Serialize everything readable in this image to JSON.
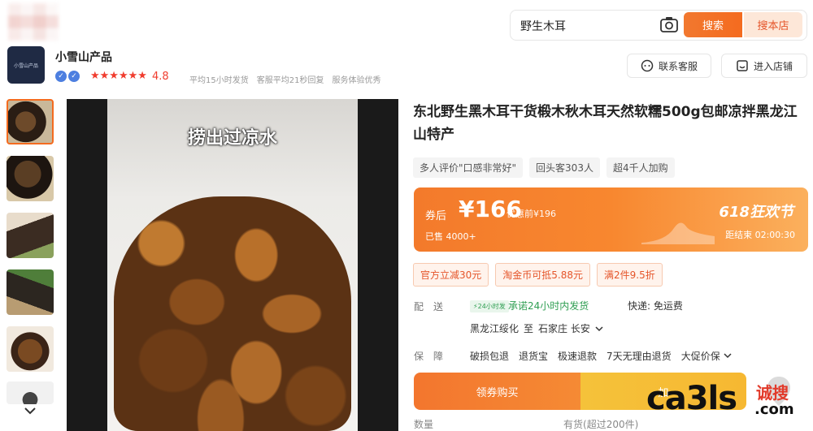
{
  "search": {
    "query": "野生木耳",
    "btn_search": "搜索",
    "btn_store": "搜本店"
  },
  "store": {
    "logo_text": "小雪山产品",
    "name": "小雪山产品",
    "stars": "★★★★★★",
    "rating": "4.8",
    "stats": [
      "平均15小时发货",
      "客服平均21秒回复",
      "服务体验优秀"
    ],
    "service_btn": "联系客服",
    "enter_btn": "进入店铺"
  },
  "image": {
    "caption": "捞出过凉水"
  },
  "product": {
    "title": "东北野生黑木耳干货椴木秋木耳天然软糯500g包邮凉拌黑龙江山特产",
    "tags": [
      "多人评价\"口感非常好\"",
      "回头客303人",
      "超4千人加购"
    ]
  },
  "promo": {
    "after_label": "券后",
    "price": "¥166",
    "before": "优惠前¥196",
    "sold": "已售 4000+",
    "festival": "618狂欢节",
    "countdown": "距结束 02:00:30"
  },
  "coupons": [
    "官方立减30元",
    "淘金币可抵5.88元",
    "满2件9.5折"
  ],
  "delivery": {
    "label": "配送",
    "flash": "⚡24小时发",
    "promise": "承诺24小时内发货",
    "shipping": "快递: 免运费",
    "from": "黑龙江绥化",
    "to_word": "至",
    "to": "石家庄 长安"
  },
  "guarantee": {
    "label": "保障",
    "items": [
      "破损包退",
      "退货宝",
      "极速退款",
      "7天无理由退货",
      "大促价保"
    ]
  },
  "buttons": {
    "coupon_buy": "领券购买",
    "add_cart": "加"
  },
  "quantity": {
    "label": "数量",
    "stock": "有货(超过200件)"
  },
  "watermark": {
    "text": "ca3ls",
    "cn": "诚搜",
    "com": ".com"
  },
  "colors": {
    "accent": "#f46b1f",
    "price_red": "#f03c2e",
    "green": "#2f9e52"
  }
}
